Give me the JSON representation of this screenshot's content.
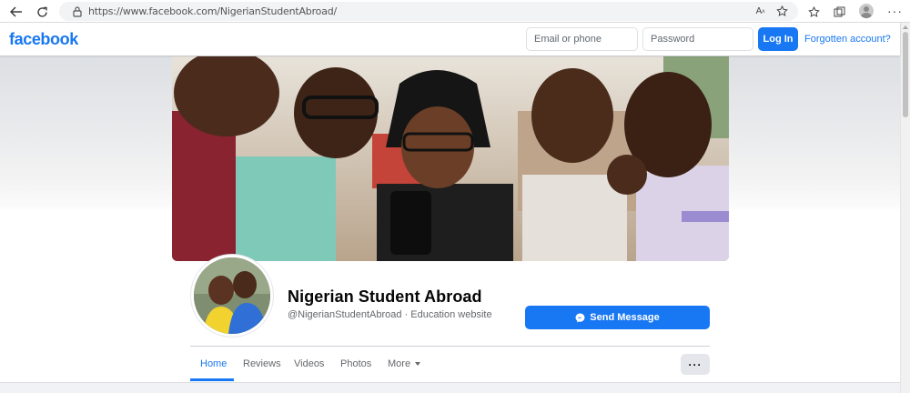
{
  "browser": {
    "url": "https://www.facebook.com/NigerianStudentAbroad/",
    "back_icon": "back-arrow-icon",
    "refresh_icon": "refresh-icon",
    "menu_dots": "···"
  },
  "header": {
    "logo": "facebook",
    "email_placeholder": "Email or phone",
    "password_placeholder": "Password",
    "login_label": "Log In",
    "forgot_label": "Forgotten account?",
    "brand_color": "#1877f2"
  },
  "profile": {
    "name": "Nigerian Student Abroad",
    "subtitle": "@NigerianStudentAbroad · Education website",
    "send_message_label": "Send Message"
  },
  "tabs": [
    {
      "label": "Home",
      "active": true
    },
    {
      "label": "Reviews"
    },
    {
      "label": "Videos"
    },
    {
      "label": "Photos"
    },
    {
      "label": "More"
    }
  ],
  "more_options_label": "···"
}
